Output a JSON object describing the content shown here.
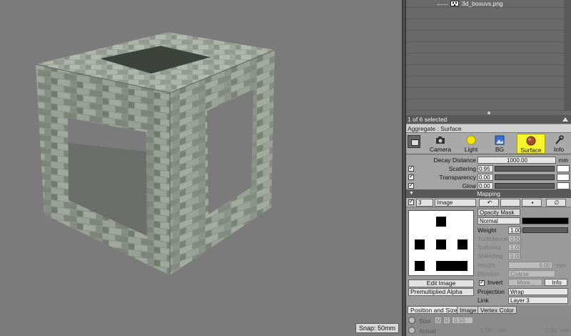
{
  "viewport": {
    "snap_label": "Snap: 50mm"
  },
  "tree": {
    "item_label": "3d_boxuvs.png"
  },
  "selection": {
    "status": "1 of 6 selected"
  },
  "aggregate": {
    "title": "Aggregate : Surface"
  },
  "tabs": [
    {
      "label": "Camera",
      "icon": "camera-icon"
    },
    {
      "label": "Light",
      "icon": "light-bulb-icon"
    },
    {
      "label": "BG",
      "icon": "background-icon"
    },
    {
      "label": "Surface",
      "icon": "surface-sphere-icon",
      "active": true
    },
    {
      "label": "Info",
      "icon": "wrench-icon"
    }
  ],
  "properties": {
    "decay_label": "Decay Distance",
    "decay_value": "1000.00",
    "decay_unit": "mm",
    "scattering_label": "Scattering",
    "scattering_value": "0.95",
    "transparency_label": "Transparency",
    "transparency_value": "0.00",
    "glow_label": "Glow",
    "glow_value": "0.00"
  },
  "mapping": {
    "section_label": "Mapping",
    "layer_number": "3",
    "layer_type": "Image",
    "edit_image": "Edit Image",
    "alpha_mode": "Premultiplied Alpha",
    "opacity_mask": "Opacity Mask",
    "blend_mode": "Normal",
    "weight_label": "Weight",
    "weight_value": "1.00",
    "turbulence_label": "Turbulence",
    "turbulence_value": "0.50",
    "softness_label": "Softness",
    "softness_value": "1.00",
    "shielding_label": "Shielding",
    "shielding_value": "0.00",
    "height_label": "Height",
    "height_value": "0.00",
    "height_unit": "mm",
    "division_label": "Division",
    "division_value": "Coarse",
    "invert_label": "Invert",
    "more_label": "More...",
    "info_label": "Info",
    "projection_label": "Projection",
    "projection_value": "Wrap",
    "link_label": "Link",
    "link_value": "Layer 3"
  },
  "bottom_tabs": [
    "Position and Size",
    "Image",
    "Vertex Color"
  ],
  "size": {
    "size_label": "Size",
    "m_label": "M",
    "r_label": "R",
    "size_value": "0.50",
    "actual_label": "Actual",
    "actual_x": "0.00",
    "actual_y": "0.00",
    "unit": "mm"
  },
  "colors": {
    "surface_tab": "#f5f52a",
    "viewport_bg": "#7b7b7b",
    "panel_bg": "#9a9a9a"
  }
}
